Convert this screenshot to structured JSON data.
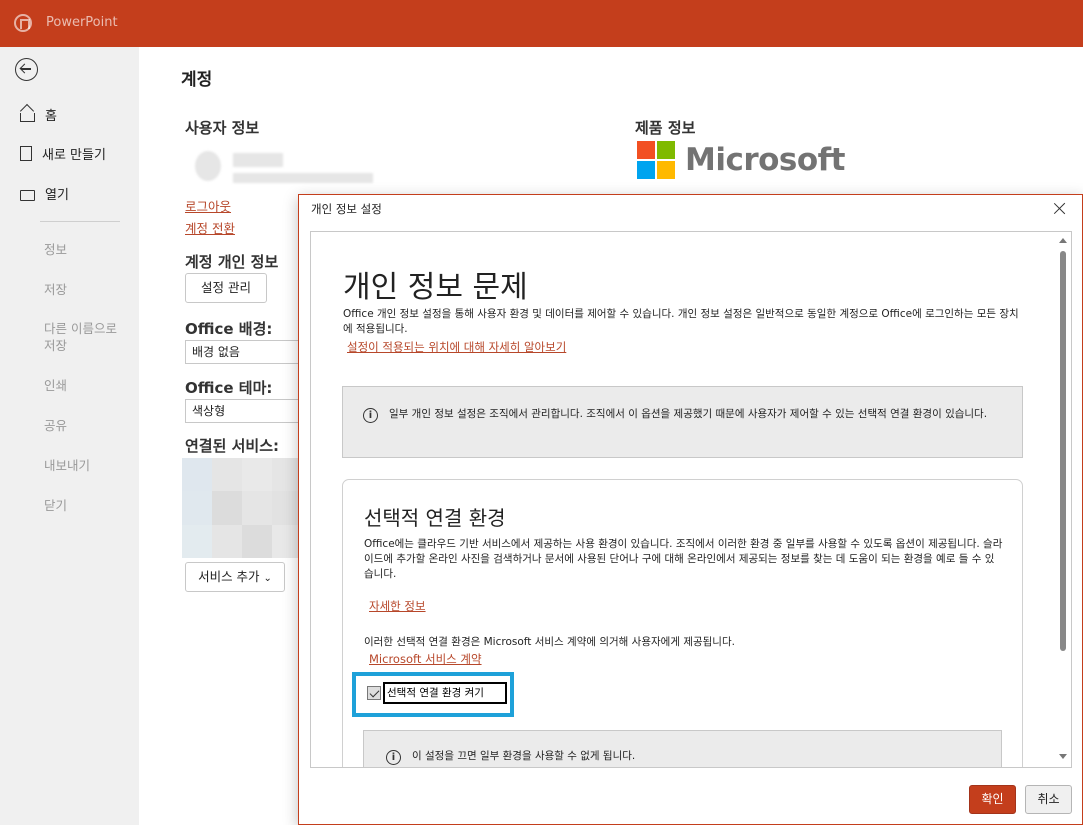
{
  "app": {
    "title": "PowerPoint"
  },
  "nav": {
    "home": "홈",
    "new": "새로 만들기",
    "open": "열기",
    "disabled": [
      "정보",
      "저장",
      "다른 이름으로 저장",
      "인쇄",
      "공유",
      "내보내기",
      "닫기"
    ]
  },
  "page": {
    "title": "계정",
    "user_info_heading": "사용자 정보",
    "logout_link": "로그아웃",
    "switch_account_link": "계정 전환",
    "privacy_heading": "계정 개인 정보",
    "manage_settings_button": "설정 관리",
    "background_label": "Office 배경:",
    "background_value": "배경 없음",
    "theme_label": "Office 테마:",
    "theme_value": "색상형",
    "connected_services_label": "연결된 서비스:",
    "add_service_button": "서비스 추가",
    "product_info_heading": "제품 정보",
    "brand_name": "Microsoft",
    "brand_colors": [
      "#f25022",
      "#7fba00",
      "#00a4ef",
      "#ffb900"
    ]
  },
  "dialog": {
    "title": "개인 정보 설정",
    "heading": "개인 정보 문제",
    "intro": "Office 개인 정보 설정을 통해 사용자 환경 및 데이터를 제어할 수 있습니다. 개인 정보 설정은 일반적으로 동일한 계정으로 Office에 로그인하는 모든 장치에 적용됩니다.",
    "learn_more_link": "설정이 적용되는 위치에 대해 자세히 알아보기",
    "managed_notice": "일부 개인 정보 설정은 조직에서 관리합니다. 조직에서 이 옵션을 제공했기 때문에 사용자가 제어할 수 있는 선택적 연결 환경이 있습니다.",
    "optional": {
      "title": "선택적 연결 환경",
      "description": "Office에는 클라우드 기반 서비스에서 제공하는 사용 환경이 있습니다. 조직에서 이러한 환경 중 일부를 사용할 수 있도록 옵션이 제공됩니다. 슬라이드에 추가할 온라인 사진을 검색하거나 문서에 사용된 단어나 구에 대해 온라인에서 제공되는 정보를 찾는 데 도움이 되는 환경을 예로 들 수 있습니다.",
      "details_link": "자세한 정보",
      "agreement_text": "이러한 선택적 연결 환경은 Microsoft 서비스 계약에 의거해 사용자에게 제공됩니다.",
      "agreement_link": "Microsoft 서비스 계약",
      "checkbox_label": "선택적 연결 환경 켜기",
      "checkbox_checked": true,
      "warning": "이 설정을 끄면 일부 환경을 사용할 수 없게 됩니다."
    },
    "ok_button": "확인",
    "cancel_button": "취소"
  }
}
